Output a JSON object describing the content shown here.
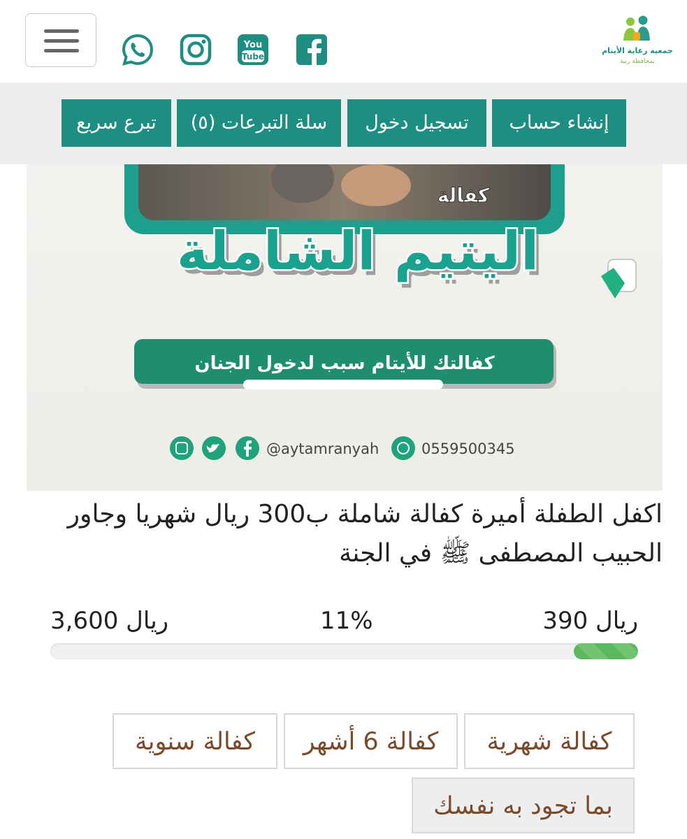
{
  "header": {
    "menu_label": "menu",
    "social": [
      {
        "name": "whatsapp-icon"
      },
      {
        "name": "instagram-icon"
      },
      {
        "name": "youtube-icon",
        "text_top": "You",
        "text_bottom": "Tube"
      },
      {
        "name": "facebook-icon"
      }
    ],
    "logo": {
      "name": "charity-logo",
      "line1": "جمعية رعاية الأيتام",
      "line2": "بمحافظة رنية"
    }
  },
  "nav": {
    "register": "إنشاء حساب",
    "login": "تسجيل دخول",
    "cart": "سلة التبرعات (٥)",
    "quick_donate": "تبرع سريع"
  },
  "banner": {
    "kafala": "كفالة",
    "title": "اليتيم الشاملة",
    "slogan": "كفالتك للأيتام سبب لدخول الجنان",
    "handle": "@aytamranyah",
    "phone": "0559500345"
  },
  "project": {
    "description": "اكفل الطفلة أميرة كفالة شاملة ب300 ريال شهريا وجاور الحبيب المصطفى ﷺ في الجنة"
  },
  "progress": {
    "collected": "390 ريال",
    "percent_label": "11%",
    "target": "3,600 ريال",
    "fraction": 0.11
  },
  "options": {
    "monthly": "كفالة شهرية",
    "six_months": "كفالة 6 أشهر",
    "yearly": "كفالة سنوية",
    "custom": "بما تجود به نفسك"
  },
  "colors": {
    "brand_teal": "#1e8e83",
    "progress_green": "#5cb85c",
    "option_text": "#7a4a2a"
  }
}
